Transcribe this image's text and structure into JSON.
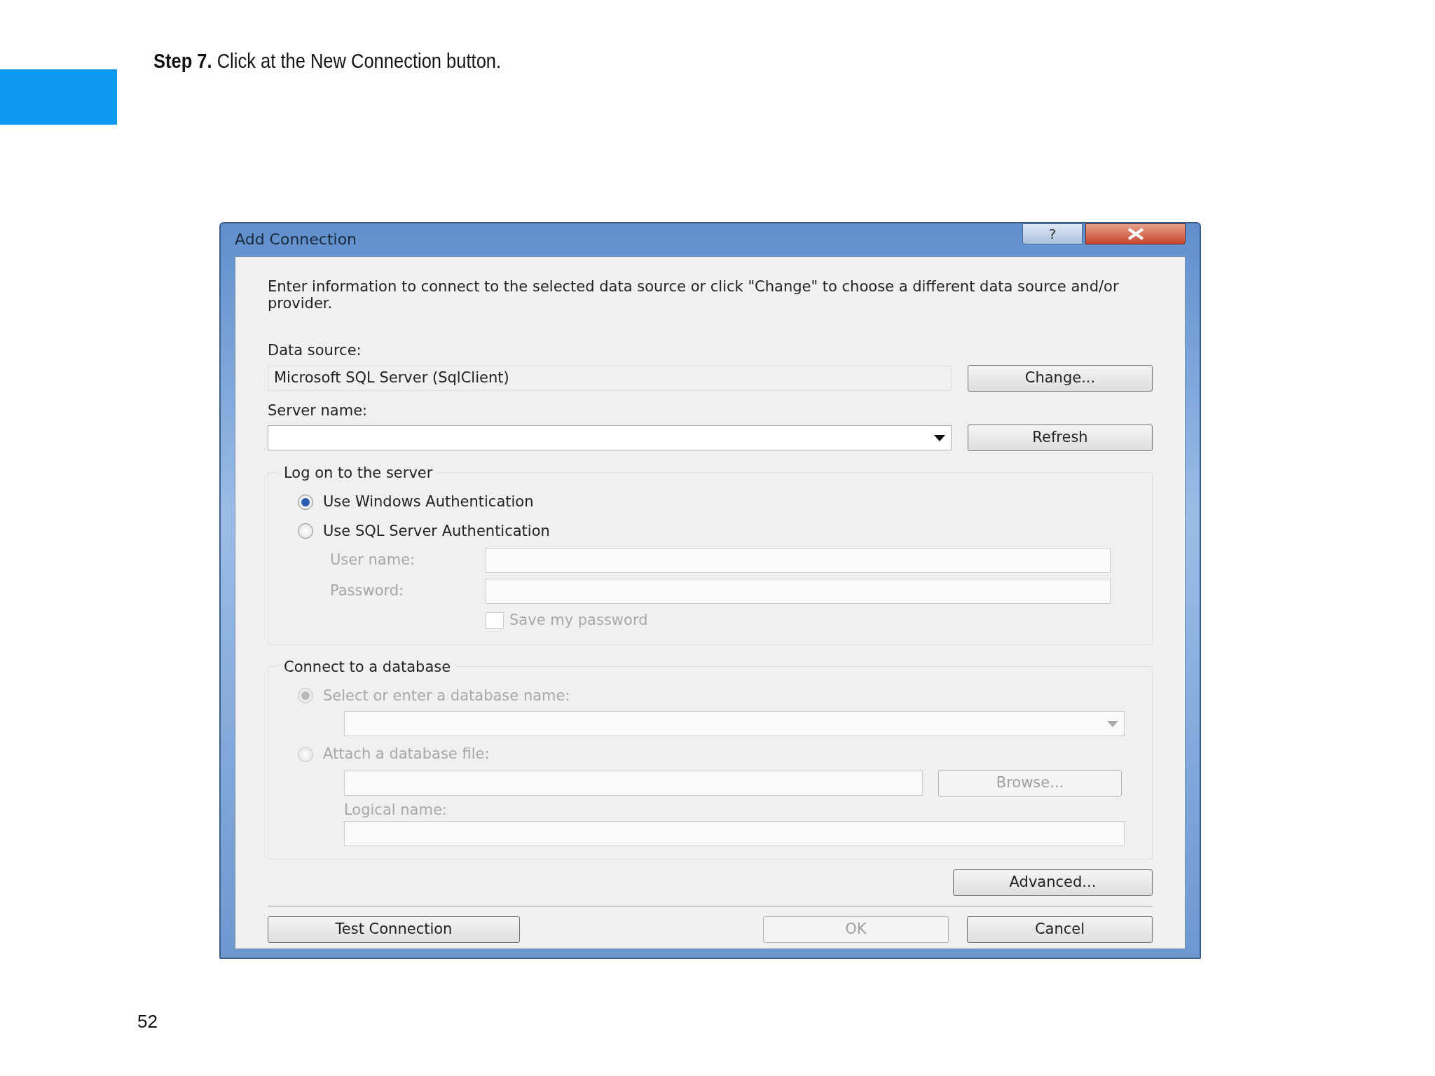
{
  "step": {
    "label": "Step 7.",
    "text": "Click at the New Connection button."
  },
  "dialog": {
    "title": "Add Connection",
    "help": "?",
    "intro": "Enter information to connect to the selected data source or click \"Change\" to choose a different data source and/or provider.",
    "data_source": {
      "label": "Data source:",
      "value": "Microsoft SQL Server (SqlClient)",
      "button": "Change..."
    },
    "server_name": {
      "label": "Server name:",
      "button": "Refresh"
    },
    "logon": {
      "legend": "Log on to the server",
      "options": [
        {
          "label": "Use Windows Authentication",
          "selected": true,
          "disabled": false
        },
        {
          "label": "Use SQL Server Authentication",
          "selected": false,
          "disabled": false
        }
      ],
      "user_name": {
        "label": "User name:",
        "disabled": true
      },
      "password": {
        "label": "Password:",
        "disabled": true
      },
      "save_password": {
        "label": "Save my password",
        "checked": false,
        "disabled": true
      }
    },
    "database": {
      "legend": "Connect to a database",
      "options": [
        {
          "label": "Select or enter a database name:",
          "selected": true,
          "disabled": true
        },
        {
          "label": "Attach a database file:",
          "selected": false,
          "disabled": true
        }
      ],
      "browse": {
        "label": "Browse...",
        "disabled": true
      },
      "logical_name": {
        "label": "Logical name:",
        "disabled": true
      }
    },
    "advanced": "Advanced...",
    "buttons": [
      {
        "label": "Test Connection",
        "disabled": false
      },
      {
        "label": "OK",
        "disabled": true
      },
      {
        "label": "Cancel",
        "disabled": false
      }
    ]
  },
  "page_number": "52"
}
